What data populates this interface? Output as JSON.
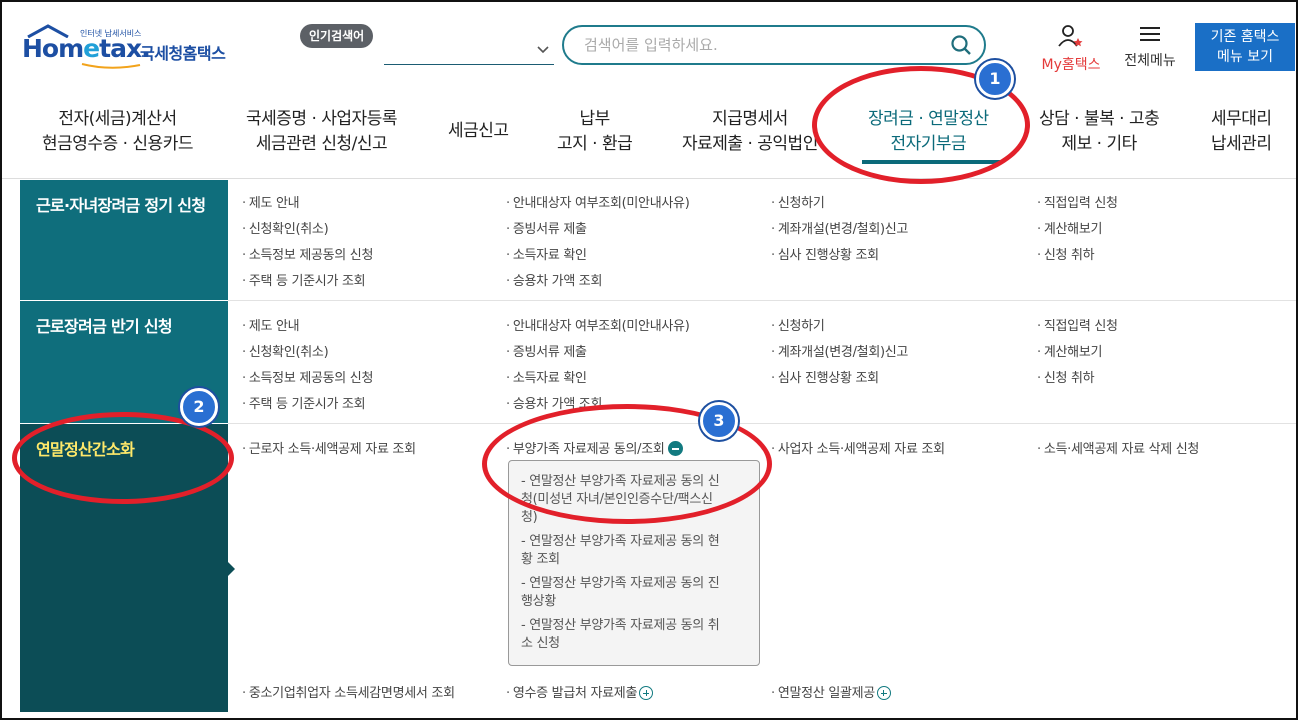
{
  "header": {
    "logo_small": "인터넷 납세서비스",
    "logo_brand_a": "Hom",
    "logo_brand_e": "e",
    "logo_brand_b": "tax.",
    "logo_org": "국세청홈택스",
    "popular_label": "인기검색어",
    "search_placeholder": "검색어를 입력하세요.",
    "my_label": "My홈택스",
    "all_menu_label": "전체메뉴",
    "old_button_line1": "기존 홈택스",
    "old_button_line2": "메뉴 보기"
  },
  "gnb": [
    {
      "line1": "전자(세금)계산서",
      "line2": "현금영수증 · 신용카드"
    },
    {
      "line1": "국세증명 · 사업자등록",
      "line2": "세금관련 신청/신고"
    },
    {
      "line1": "세금신고",
      "line2": ""
    },
    {
      "line1": "납부",
      "line2": "고지 · 환급"
    },
    {
      "line1": "지급명세서",
      "line2": "자료제출 · 공익법인"
    },
    {
      "line1": "장려금 · 연말정산",
      "line2": "전자기부금"
    },
    {
      "line1": "상담 · 불복 · 고충",
      "line2": "제보 · 기타"
    },
    {
      "line1": "세무대리",
      "line2": "납세관리"
    }
  ],
  "sections": [
    {
      "title": "근로·자녀장려금 정기 신청",
      "links": [
        "제도 안내",
        "안내대상자 여부조회(미안내사유)",
        "신청하기",
        "직접입력 신청",
        "신청확인(취소)",
        "증빙서류 제출",
        "계좌개설(변경/철회)신고",
        "계산해보기",
        "소득정보 제공동의 신청",
        "소득자료 확인",
        "심사 진행상황 조회",
        "신청 취하",
        "주택 등 기준시가 조회",
        "승용차 가액 조회"
      ]
    },
    {
      "title": "근로장려금 반기 신청",
      "links": [
        "제도 안내",
        "안내대상자 여부조회(미안내사유)",
        "신청하기",
        "직접입력 신청",
        "신청확인(취소)",
        "증빙서류 제출",
        "계좌개설(변경/철회)신고",
        "계산해보기",
        "소득정보 제공동의 신청",
        "소득자료 확인",
        "심사 진행상황 조회",
        "신청 취하",
        "주택 등 기준시가 조회",
        "승용차 가액 조회"
      ]
    },
    {
      "title": "연말정산간소화",
      "links": [
        "근로자 소득·세액공제 자료 조회",
        "부양가족 자료제공 동의/조회",
        "사업자 소득·세액공제 자료 조회",
        "소득·세액공제 자료 삭제 신청",
        "중소기업취업자 소득세감면명세서 조회",
        "영수증 발급처 자료제출",
        "연말정산 일괄제공"
      ],
      "submenu": [
        {
          "line1": "- 연말정산 부양가족 자료제공 동의 신",
          "line2": "청(미성년 자녀/본인인증수단/팩스신",
          "line3": "청)"
        },
        {
          "line1": "- 연말정산 부양가족 자료제공 동의 현",
          "line2": "황 조회",
          "line3": ""
        },
        {
          "line1": "- 연말정산 부양가족 자료제공 동의 진",
          "line2": "행상황",
          "line3": ""
        },
        {
          "line1": "- 연말정산 부양가족 자료제공 동의 취",
          "line2": "소 신청",
          "line3": ""
        }
      ]
    }
  ],
  "annotations": [
    "1",
    "2",
    "3"
  ],
  "colors": {
    "teal": "#0f6e7c",
    "teal_dark": "#0c4d56",
    "annot_red": "#e2202a",
    "badge_blue": "#2a6fd2",
    "my_red": "#e43b3b",
    "old_btn_blue": "#1a6fc6"
  }
}
